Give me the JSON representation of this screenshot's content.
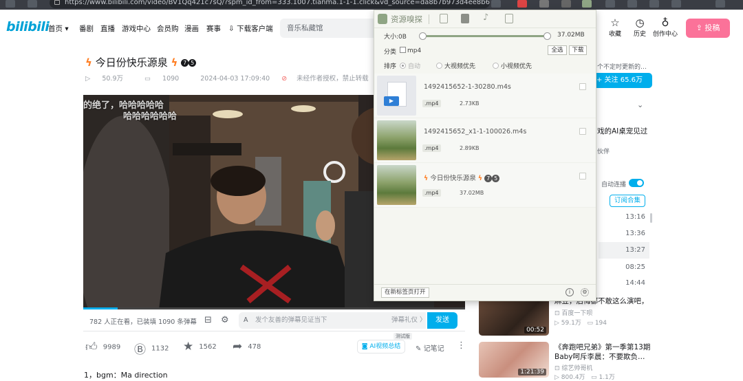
{
  "browser": {
    "url": "https://www.bilibili.com/video/BV1Qq421c7sQ/?spm_id_from=333.1007.tianma.1-1-1.click&vd_source=da8b7b973d4ee8b6e87cf"
  },
  "header": {
    "logo": "bilibili",
    "nav": [
      "首页",
      "番剧",
      "直播",
      "游戏中心",
      "会员购",
      "漫画",
      "赛事",
      "下载客户端"
    ],
    "search_placeholder": "音乐私藏馆",
    "icons": [
      {
        "label": "收藏",
        "icon": "star-icon"
      },
      {
        "label": "历史",
        "icon": "clock-icon"
      },
      {
        "label": "创作中心",
        "icon": "bulb-icon"
      }
    ],
    "upload_label": "投稿"
  },
  "video": {
    "title": "今日份快乐源泉",
    "views": "50.9万",
    "danmaku_count": "1090",
    "date": "2024-04-03 17:09:40",
    "copyright": "未经作者授权，禁止转载",
    "danmaku_lines": [
      "的绝了，哈哈哈哈哈",
      "哈哈哈哈哈哈"
    ],
    "progress": 0.09,
    "viewers_text": "782 人正在看，已装填 1090 条弹幕",
    "danmu_placeholder": "发个友善的弹幕见证当下",
    "etiquette": "弹幕礼仪 〉",
    "send_label": "发送",
    "likes": "9989",
    "coins": "1132",
    "favorites": "1562",
    "shares": "478",
    "ai_summary": "AI视频总结",
    "ai_tag": "测试版",
    "notes": "记笔记",
    "desc": "1，bgm：Ma direction"
  },
  "sidebar": {
    "up_desc": "个不定时更新的…",
    "follow_label": "+ 关注 65.6万",
    "promo_title": "戏的AI桌宠见过",
    "promo_sub": "伙伴",
    "autoplay_label": "自动连播",
    "subscribe_collection": "订阅合集",
    "durations": [
      "13:16",
      "13:36",
      "13:27",
      "08:25",
      "14:44"
    ],
    "active_duration_index": 2,
    "recos": [
      {
        "title": "麻豆，后悔都不敢这么演吧，",
        "author": "百度一下呗",
        "views": "59.1万",
        "danmaku": "194",
        "duration": "00:52"
      },
      {
        "title": "《奔跑吧兄弟》第一季第13期",
        "title2": "Baby呵斥李晨：不要欺负…",
        "author": "综艺帅哥机",
        "views": "800.4万",
        "danmaku": "1.1万",
        "duration": "1:21:39"
      }
    ]
  },
  "sniffer": {
    "title": "资源嗅探",
    "size_label": "大小:",
    "size_min": "0B",
    "size_max": "37.02MB",
    "category_label": "分类",
    "category_option": "mp4",
    "select_all": "全选",
    "download": "下载",
    "sort_label": "排序",
    "sort_options": [
      "自动",
      "大视频优先",
      "小视频优先"
    ],
    "sort_selected": "自动",
    "items": [
      {
        "name": "1492415652-1-30280.m4s",
        "ext": ".mp4",
        "size": "2.73KB"
      },
      {
        "name": "1492415652_x1-1-100026.m4s",
        "ext": ".mp4",
        "size": "2.89KB"
      },
      {
        "name": "今日份快乐源泉",
        "ext": ".mp4",
        "size": "37.02MB"
      }
    ],
    "open_new_tab": "在新标签页打开",
    "info_glyph": "i"
  },
  "colors": {
    "accent_blue": "#00aeec",
    "bili_pink": "#fb7299",
    "sniffer_green": "#8fa584"
  }
}
